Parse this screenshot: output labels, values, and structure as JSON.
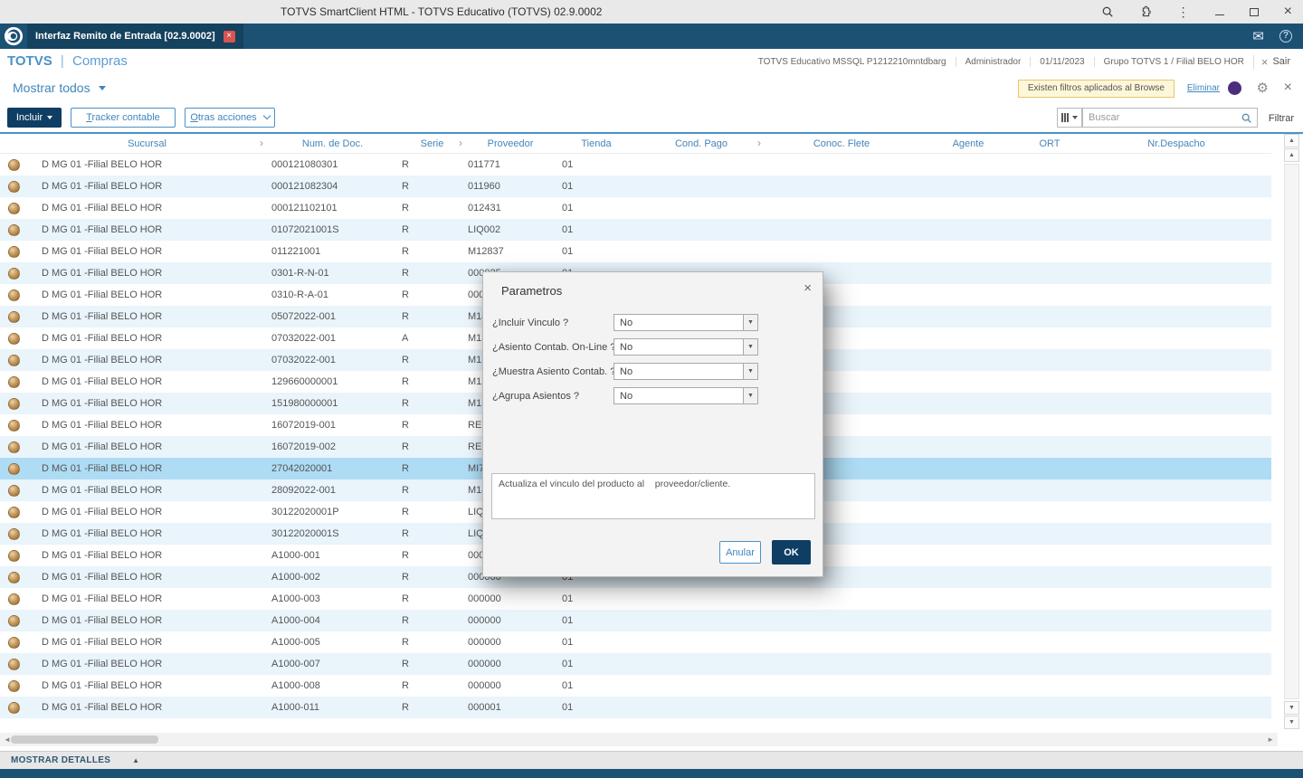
{
  "window": {
    "title": "TOTVS SmartClient HTML - TOTVS Educativo (TOTVS) 02.9.0002"
  },
  "tab_bar": {
    "active_tab": "Interfaz Remito de Entrada [02.9.0002]"
  },
  "app_header": {
    "brand": "TOTVS",
    "divider": "|",
    "module": "Compras",
    "environment": "TOTVS Educativo MSSQL P1212210mntdbarg",
    "user": "Administrador",
    "date": "01/11/2023",
    "branch": "Grupo TOTVS 1 / Filial BELO HOR",
    "exit": "Sair"
  },
  "browse_bar": {
    "view_selector": "Mostrar todos",
    "filter_notice": "Existen filtros aplicados al Browse",
    "clear_filter": "Eliminar"
  },
  "toolbar": {
    "include": "Incluir",
    "tracker": "Tracker contable",
    "other_actions": "Otras acciones",
    "search_placeholder": "Buscar",
    "filter": "Filtrar"
  },
  "grid": {
    "columns": [
      {
        "label": "Sucursal",
        "sort": true
      },
      {
        "label": "Num. de Doc.",
        "sort": false
      },
      {
        "label": "Serie",
        "sort": true
      },
      {
        "label": "Proveedor",
        "sort": false
      },
      {
        "label": "Tienda",
        "sort": false
      },
      {
        "label": "Cond. Pago",
        "sort": true
      },
      {
        "label": "Conoc. Flete",
        "sort": false
      },
      {
        "label": "Agente",
        "sort": false
      },
      {
        "label": "ORT",
        "sort": false
      },
      {
        "label": "Nr.Despacho",
        "sort": false
      }
    ],
    "selected_row": 14,
    "rows": [
      [
        "D MG 01 -Filial BELO HOR",
        "000121080301",
        "R",
        "011771",
        "01"
      ],
      [
        "D MG 01 -Filial BELO HOR",
        "000121082304",
        "R",
        "011960",
        "01"
      ],
      [
        "D MG 01 -Filial BELO HOR",
        "000121102101",
        "R",
        "012431",
        "01"
      ],
      [
        "D MG 01 -Filial BELO HOR",
        "01072021001S",
        "R",
        "LIQ002",
        "01"
      ],
      [
        "D MG 01 -Filial BELO HOR",
        "011221001",
        "R",
        "M12837",
        "01"
      ],
      [
        "D MG 01 -Filial BELO HOR",
        "0301-R-N-01",
        "R",
        "000025",
        "01"
      ],
      [
        "D MG 01 -Filial BELO HOR",
        "0310-R-A-01",
        "R",
        "0000",
        ""
      ],
      [
        "D MG 01 -Filial BELO HOR",
        "05072022-001",
        "R",
        "M14",
        ""
      ],
      [
        "D MG 01 -Filial BELO HOR",
        "07032022-001",
        "A",
        "M13",
        ""
      ],
      [
        "D MG 01 -Filial BELO HOR",
        "07032022-001",
        "R",
        "M13",
        ""
      ],
      [
        "D MG 01 -Filial BELO HOR",
        "129660000001",
        "R",
        "M12",
        ""
      ],
      [
        "D MG 01 -Filial BELO HOR",
        "151980000001",
        "R",
        "M15",
        ""
      ],
      [
        "D MG 01 -Filial BELO HOR",
        "16072019-001",
        "R",
        "REM",
        ""
      ],
      [
        "D MG 01 -Filial BELO HOR",
        "16072019-002",
        "R",
        "REM",
        ""
      ],
      [
        "D MG 01 -Filial BELO HOR",
        "27042020001",
        "R",
        "MI77",
        ""
      ],
      [
        "D MG 01 -Filial BELO HOR",
        "28092022-001",
        "R",
        "M14",
        ""
      ],
      [
        "D MG 01 -Filial BELO HOR",
        "30122020001P",
        "R",
        "LIQ0",
        ""
      ],
      [
        "D MG 01 -Filial BELO HOR",
        "30122020001S",
        "R",
        "LIQ0",
        ""
      ],
      [
        "D MG 01 -Filial BELO HOR",
        "A1000-001",
        "R",
        "0000",
        ""
      ],
      [
        "D MG 01 -Filial BELO HOR",
        "A1000-002",
        "R",
        "000000",
        "01"
      ],
      [
        "D MG 01 -Filial BELO HOR",
        "A1000-003",
        "R",
        "000000",
        "01"
      ],
      [
        "D MG 01 -Filial BELO HOR",
        "A1000-004",
        "R",
        "000000",
        "01"
      ],
      [
        "D MG 01 -Filial BELO HOR",
        "A1000-005",
        "R",
        "000000",
        "01"
      ],
      [
        "D MG 01 -Filial BELO HOR",
        "A1000-007",
        "R",
        "000000",
        "01"
      ],
      [
        "D MG 01 -Filial BELO HOR",
        "A1000-008",
        "R",
        "000000",
        "01"
      ],
      [
        "D MG 01 -Filial BELO HOR",
        "A1000-011",
        "R",
        "000001",
        "01"
      ]
    ]
  },
  "dialog": {
    "title": "Parametros",
    "fields": [
      {
        "label": "¿Incluir Vinculo ?",
        "value": "No"
      },
      {
        "label": "¿Asiento Contab. On-Line ?",
        "value": "No"
      },
      {
        "label": "¿Muestra Asiento Contab. ?",
        "value": "No"
      },
      {
        "label": "¿Agrupa Asientos ?",
        "value": "No"
      }
    ],
    "description": "Actualiza el vinculo del producto al    proveedor/cliente.",
    "cancel": "Anular",
    "ok": "OK"
  },
  "footer": {
    "details": "MOSTRAR DETALLES"
  },
  "colors": {
    "topbar": "#1c5174",
    "accent_blue": "#4b92c8",
    "primary_button": "#0e3e64",
    "selection": "#aedcf4",
    "row_alt": "#e9f4fb",
    "filter_notice_bg": "#fdf6d8"
  }
}
